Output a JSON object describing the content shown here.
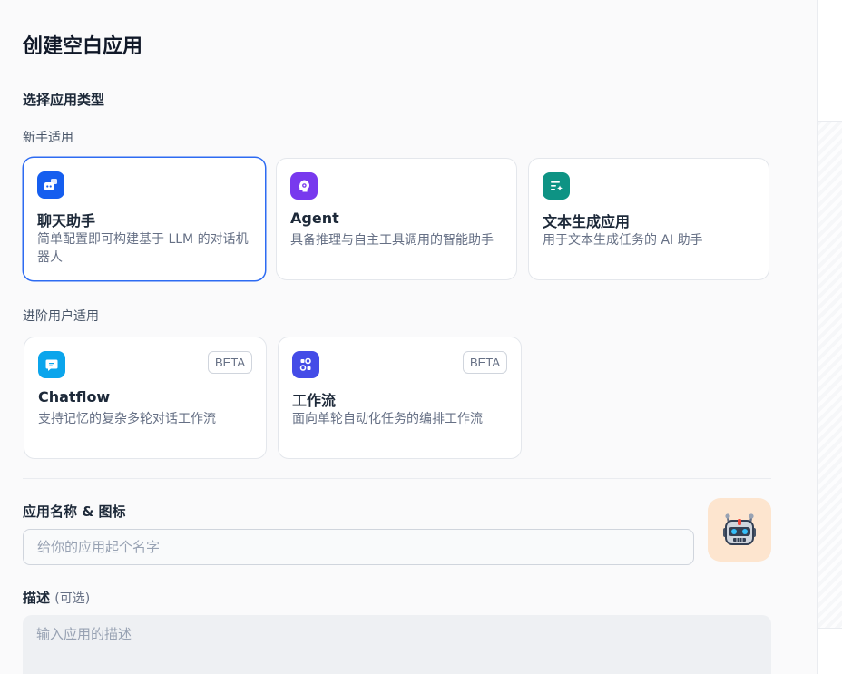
{
  "dialog": {
    "title": "创建空白应用",
    "section_title": "选择应用类型"
  },
  "beginner": {
    "label": "新手适用",
    "cards": [
      {
        "name": "聊天助手",
        "desc": "简单配置即可构建基于 LLM 的对话机器人",
        "icon": "chat-bot-icon",
        "color": "#155eef",
        "selected": true
      },
      {
        "name": "Agent",
        "desc": "具备推理与自主工具调用的智能助手",
        "icon": "agent-icon",
        "color": "#7839ee",
        "selected": false
      },
      {
        "name": "文本生成应用",
        "desc": "用于文本生成任务的 AI 助手",
        "icon": "text-generation-icon",
        "color": "#0e9384",
        "selected": false
      }
    ]
  },
  "advanced": {
    "label": "进阶用户适用",
    "cards": [
      {
        "name": "Chatflow",
        "desc": "支持记忆的复杂多轮对话工作流",
        "badge": "BETA",
        "icon": "chatflow-icon",
        "color": "#0ba5ec"
      },
      {
        "name": "工作流",
        "desc": "面向单轮自动化任务的编排工作流",
        "badge": "BETA",
        "icon": "workflow-icon",
        "color": "#444ce7"
      }
    ]
  },
  "form": {
    "name_label": "应用名称 & 图标",
    "name_placeholder": "给你的应用起个名字",
    "desc_label": "描述",
    "desc_optional": "(可选)",
    "desc_placeholder": "输入应用的描述",
    "avatar_icon": "robot-emoji-icon",
    "avatar_bg": "#fde5cf"
  }
}
